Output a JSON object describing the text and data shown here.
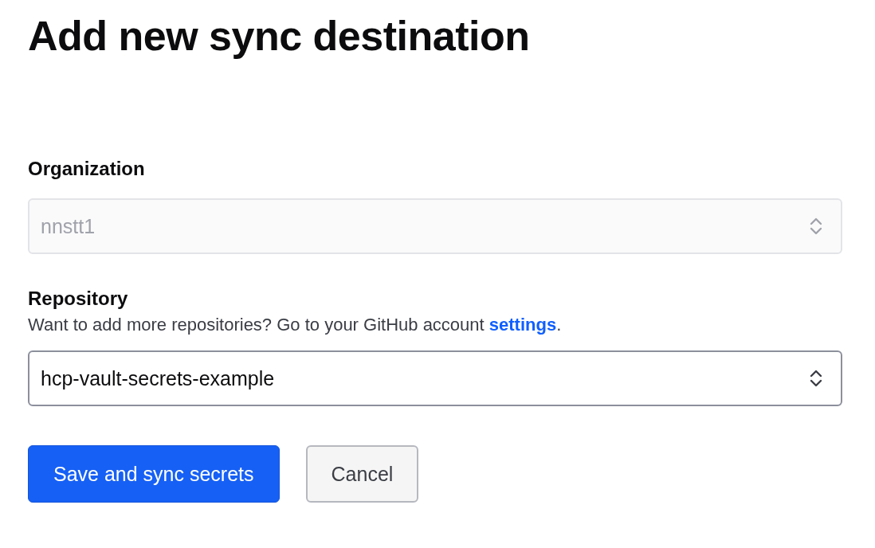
{
  "title": "Add new sync destination",
  "fields": [
    {
      "label": "Organization",
      "value": "nnstt1",
      "disabled": true
    },
    {
      "label": "Repository",
      "help": {
        "text": "Want to add more repositories? Go to your GitHub account ",
        "link": "settings",
        "after": "."
      },
      "value": "hcp-vault-secrets-example",
      "disabled": false
    }
  ],
  "buttons": [
    {
      "label": "Save and sync secrets",
      "kind": "primary"
    },
    {
      "label": "Cancel",
      "kind": "secondary"
    }
  ]
}
